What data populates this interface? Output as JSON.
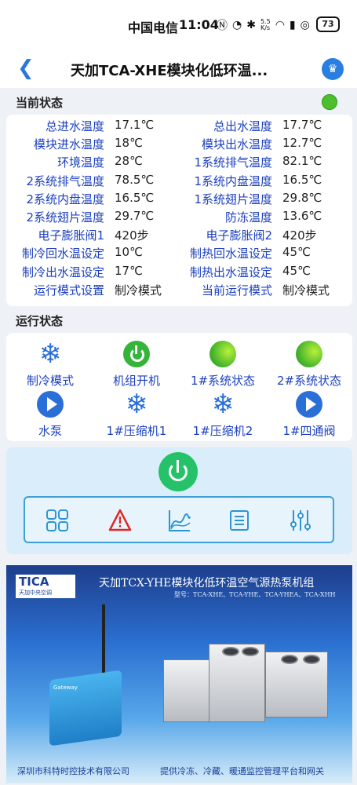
{
  "status_bar": {
    "carrier": "中国电信",
    "time": "11:04",
    "net_speed": "5.5\nK/s",
    "battery": "73"
  },
  "nav": {
    "title": "天加TCA-XHE模块化低环温..."
  },
  "current_status": {
    "title": "当前状态",
    "indicator_color": "#4cbf2f",
    "params": [
      {
        "label_left": "总进水温度",
        "value_left": "17.1℃",
        "label_right": "总出水温度",
        "value_right": "17.7℃"
      },
      {
        "label_left": "模块进水温度",
        "value_left": "18℃",
        "label_right": "模块出水温度",
        "value_right": "12.7℃"
      },
      {
        "label_left": "环境温度",
        "value_left": "28℃",
        "label_right": "1系统排气温度",
        "value_right": "82.1℃"
      },
      {
        "label_left": "2系统排气温度",
        "value_left": "78.5℃",
        "label_right": "1系统内盘温度",
        "value_right": "16.5℃"
      },
      {
        "label_left": "2系统内盘温度",
        "value_left": "16.5℃",
        "label_right": "1系统翅片温度",
        "value_right": "29.8℃"
      },
      {
        "label_left": "2系统翅片温度",
        "value_left": "29.7℃",
        "label_right": "防冻温度",
        "value_right": "13.6℃"
      },
      {
        "label_left": "电子膨胀阀1",
        "value_left": "420步",
        "label_right": "电子膨胀阀2",
        "value_right": "420步"
      },
      {
        "label_left": "制冷回水温设定",
        "value_left": "10℃",
        "label_right": "制热回水温设定",
        "value_right": "45℃"
      },
      {
        "label_left": "制冷出水温设定",
        "value_left": "17℃",
        "label_right": "制热出水温设定",
        "value_right": "45℃"
      },
      {
        "label_left": "运行模式设置",
        "value_left": "制冷模式",
        "label_right": "当前运行模式",
        "value_right": "制冷模式"
      }
    ]
  },
  "run_status": {
    "title": "运行状态",
    "items": [
      {
        "label": "制冷模式",
        "icon": "snowflake-icon"
      },
      {
        "label": "机组开机",
        "icon": "power-icon"
      },
      {
        "label": "1#系统状态",
        "icon": "green-ball-icon"
      },
      {
        "label": "2#系统状态",
        "icon": "green-ball-icon"
      },
      {
        "label": "水泵",
        "icon": "play-icon"
      },
      {
        "label": "1#压缩机1",
        "icon": "snowflake-icon"
      },
      {
        "label": "1#压缩机2",
        "icon": "snowflake-icon"
      },
      {
        "label": "1#四通阀",
        "icon": "play-icon"
      }
    ]
  },
  "controls": {
    "power_icon": "power-button-icon",
    "tools": [
      "grid-icon",
      "alarm-icon",
      "chart-icon",
      "list-icon",
      "settings-sliders-icon"
    ]
  },
  "banner": {
    "logo": "TICA",
    "logo_sub": "天加中央空调",
    "title": "天加TCX-YHE模块化低环温空气源热泵机组",
    "models": "型号：TCA-XHE、TCA-YHE、TCA-YHEA、TCA-XHH",
    "gateway_label": "Gateway",
    "footer_left": "深圳市科特时控技术有限公司",
    "footer_right": "提供冷冻、冷藏、暖通监控管理平台和网关"
  }
}
